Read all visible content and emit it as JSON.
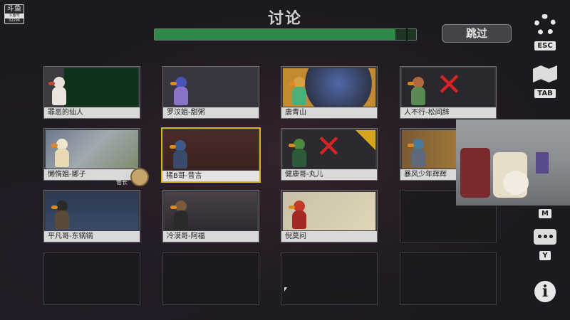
{
  "logo": {
    "text": "斗鱼",
    "sub": "斗鱼号",
    "num": "32296"
  },
  "header": {
    "title": "讨论",
    "skip_label": "跳过",
    "progress": 0.92
  },
  "manager_label": "管长",
  "players": [
    {
      "name": "罪恶的仙人",
      "eliminated": false,
      "selected": false
    },
    {
      "name": "罗汉姐-甜粥",
      "eliminated": false,
      "selected": false
    },
    {
      "name": "唐青山",
      "eliminated": false,
      "selected": false
    },
    {
      "name": "人不行-松间辞",
      "eliminated": true,
      "selected": false
    },
    {
      "name": "懒惰姐-娜子",
      "eliminated": false,
      "selected": false
    },
    {
      "name": "猪B哥-昔言",
      "eliminated": false,
      "selected": true
    },
    {
      "name": "健康哥-丸儿",
      "eliminated": true,
      "selected": false
    },
    {
      "name": "暴风少年辉辉",
      "eliminated": false,
      "selected": false
    },
    {
      "name": "平凡哥-东锅锅",
      "eliminated": false,
      "selected": false
    },
    {
      "name": "冷漠哥-阿福",
      "eliminated": false,
      "selected": false
    },
    {
      "name": "倪莫问",
      "eliminated": false,
      "selected": false
    }
  ],
  "side_menu": {
    "settings_key": "ESC",
    "map_key": "TAB",
    "m_key": "M",
    "chat_key": "Y"
  },
  "colors": {
    "progress": "#2f8a4a",
    "selected_border": "#d9b320",
    "eliminated_x": "#d42424"
  }
}
